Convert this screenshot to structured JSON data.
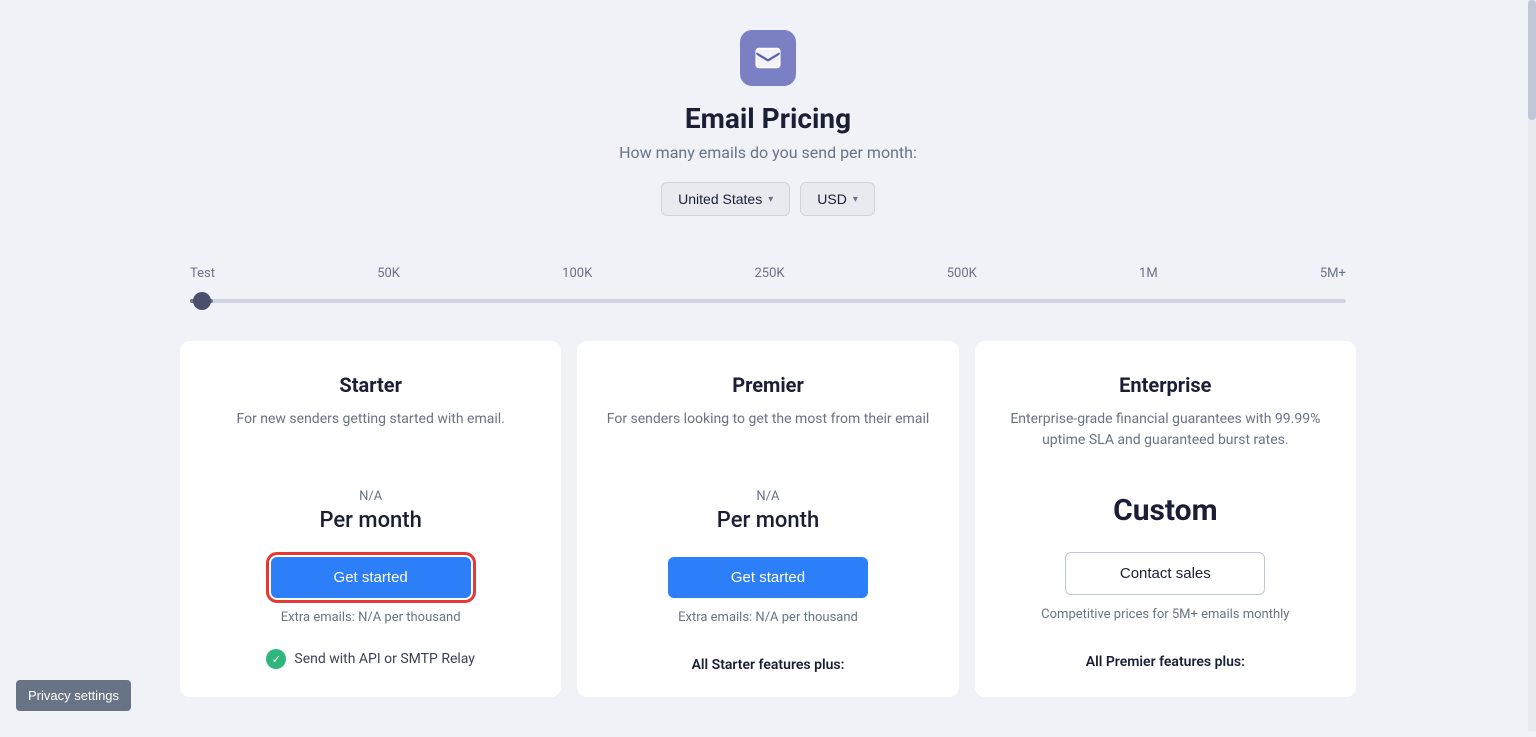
{
  "header": {
    "icon_label": "email-icon",
    "title": "Email Pricing",
    "subtitle": "How many emails do you send per month:",
    "country_selector": "United States",
    "currency_selector": "USD"
  },
  "slider": {
    "labels": [
      "Test",
      "50K",
      "100K",
      "250K",
      "500K",
      "1M",
      "5M+"
    ]
  },
  "plans": [
    {
      "id": "starter",
      "name": "Starter",
      "description": "For new senders getting started with email.",
      "price_label": "N/A",
      "price": "Per month",
      "cta_label": "Get started",
      "cta_type": "primary",
      "highlighted": true,
      "extra_emails": "Extra emails: N/A per thousand",
      "feature": "Send with API or SMTP Relay",
      "bottom_label": ""
    },
    {
      "id": "premier",
      "name": "Premier",
      "description": "For senders looking to get the most from their email",
      "price_label": "N/A",
      "price": "Per month",
      "cta_label": "Get started",
      "cta_type": "primary",
      "highlighted": false,
      "extra_emails": "Extra emails: N/A per thousand",
      "feature": "",
      "bottom_label": "All Starter features plus:"
    },
    {
      "id": "enterprise",
      "name": "Enterprise",
      "description": "Enterprise-grade financial guarantees with 99.99% uptime SLA and guaranteed burst rates.",
      "price_label": "",
      "price": "Custom",
      "cta_label": "Contact sales",
      "cta_type": "secondary",
      "highlighted": false,
      "extra_emails": "Competitive prices for 5M+ emails monthly",
      "feature": "",
      "bottom_label": "All Premier features plus:"
    }
  ],
  "privacy_settings": {
    "label": "Privacy settings"
  }
}
